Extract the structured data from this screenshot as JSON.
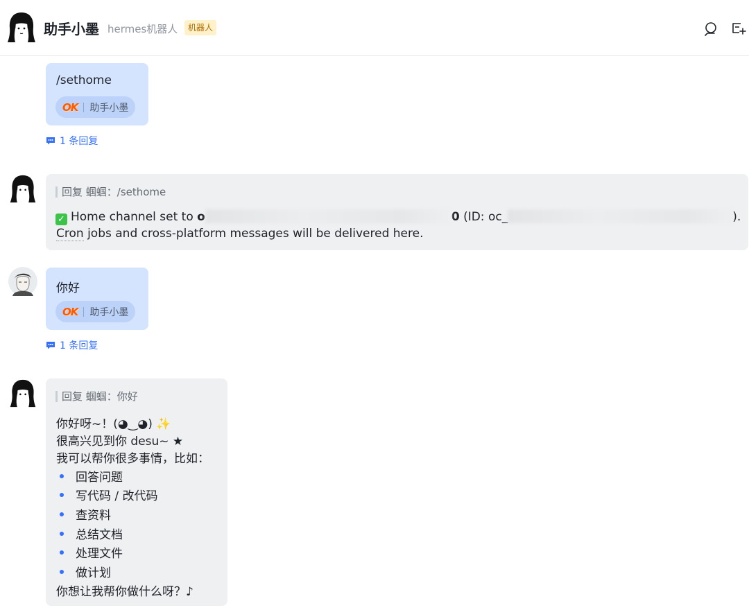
{
  "header": {
    "title": "助手小墨",
    "subtitle": "hermes机器人",
    "bot_tag": "机器人",
    "icons": [
      "search-icon",
      "new-chat-icon"
    ]
  },
  "messages": [
    {
      "sender": "me",
      "text": "/sethome",
      "reaction": {
        "emoji": "OK",
        "who": "助手小墨"
      },
      "reply_count": "1 条回复"
    },
    {
      "sender": "bot",
      "quote": "回复 蝈蝈：/sethome",
      "line1": {
        "prefix": "Home channel set to ",
        "name_start": "o",
        "name_end": "0",
        "id_prefix": " (ID: oc_",
        "id_suffix": ")."
      },
      "line2": {
        "underlined": "Cron",
        "rest": " jobs and cross-platform messages will be delivered here."
      }
    },
    {
      "sender": "me",
      "text": "你好",
      "reaction": {
        "emoji": "OK",
        "who": "助手小墨"
      },
      "reply_count": "1 条回复"
    },
    {
      "sender": "bot",
      "quote": "回复 蝈蝈：你好",
      "lines": [
        "你好呀~！(◕‿◕)",
        "很高兴见到你 desu~ ★",
        "我可以帮你很多事情，比如："
      ],
      "sparkle": "✨",
      "list": [
        "回答问题",
        "写代码 / 改代码",
        "查资料",
        "总结文档",
        "处理文件",
        "做计划"
      ],
      "closing": "你想让我帮你做什么呀？♪"
    }
  ],
  "colors": {
    "accent": "#3370ff",
    "my_bubble": "#d4e3fe",
    "bot_bubble": "#eff0f1",
    "reaction": "#bcd2f9"
  }
}
